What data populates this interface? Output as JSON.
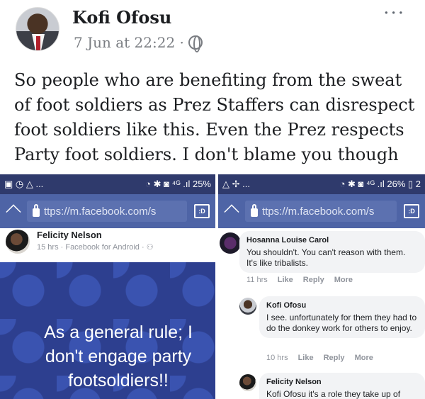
{
  "post": {
    "author": "Kofi Ofosu",
    "timestamp": "7 Jun at 22:22 ·",
    "more": "···",
    "text": "So people who are benefiting from the sweat of foot soldiers as Prez Staffers can disrespect foot soldiers like this. Even the Prez respects Party foot soldiers. I don't blame you though ..."
  },
  "left_shot": {
    "status_left": "▣ ◷ △ ...",
    "status_right": "◔ ✱ ◙ ⁴ᴳ .ıl 25%",
    "url": "ttps://m.facebook.com/s",
    "desktop": ":D",
    "poster": "Felicity Nelson",
    "meta": "15 hrs · Facebook for Android · ⚇",
    "quote": "As a general rule; I don't engage party footsoldiers!!"
  },
  "right_shot": {
    "status_left": "△ ✢ ...",
    "status_right": "◔ ✱ ◙ ⁴ᴳ .ıl 26% ▯ 2",
    "url": "ttps://m.facebook.com/s",
    "desktop": ":D",
    "comments": [
      {
        "name": "Hosanna Louise Carol",
        "text": "You shouldn't. You can't reason with them. It's like tribalists.",
        "time": "11 hrs",
        "like": "Like",
        "reply": "Reply",
        "more": "More"
      },
      {
        "name": "Kofi Ofosu",
        "text": "I see. unfortunately for them they had to do the donkey work for others to enjoy.",
        "time": "10 hrs",
        "like": "Like",
        "reply": "Reply",
        "more": "More"
      },
      {
        "name": "Felicity Nelson",
        "text": "Kofi Ofosu it's a role they take up of"
      }
    ]
  }
}
